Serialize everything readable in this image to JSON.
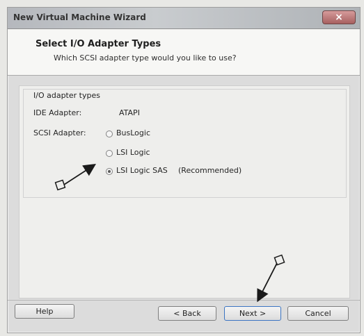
{
  "window": {
    "title": "New Virtual Machine Wizard",
    "close_label": "×"
  },
  "header": {
    "title": "Select I/O Adapter Types",
    "subtitle": "Which SCSI adapter type would you like to use?"
  },
  "section": {
    "title": "I/O adapter types",
    "ide_label": "IDE Adapter:",
    "ide_value": "ATAPI",
    "scsi_label": "SCSI Adapter:"
  },
  "scsi_options": [
    {
      "label": "BusLogic",
      "selected": false
    },
    {
      "label": "LSI Logic",
      "selected": false
    },
    {
      "label": "LSI Logic SAS",
      "selected": true,
      "note": "(Recommended)"
    }
  ],
  "buttons": {
    "help": "Help",
    "back": "< Back",
    "next": "Next >",
    "cancel": "Cancel"
  },
  "annotations": {
    "arrow_color": "#1a1a1a"
  }
}
